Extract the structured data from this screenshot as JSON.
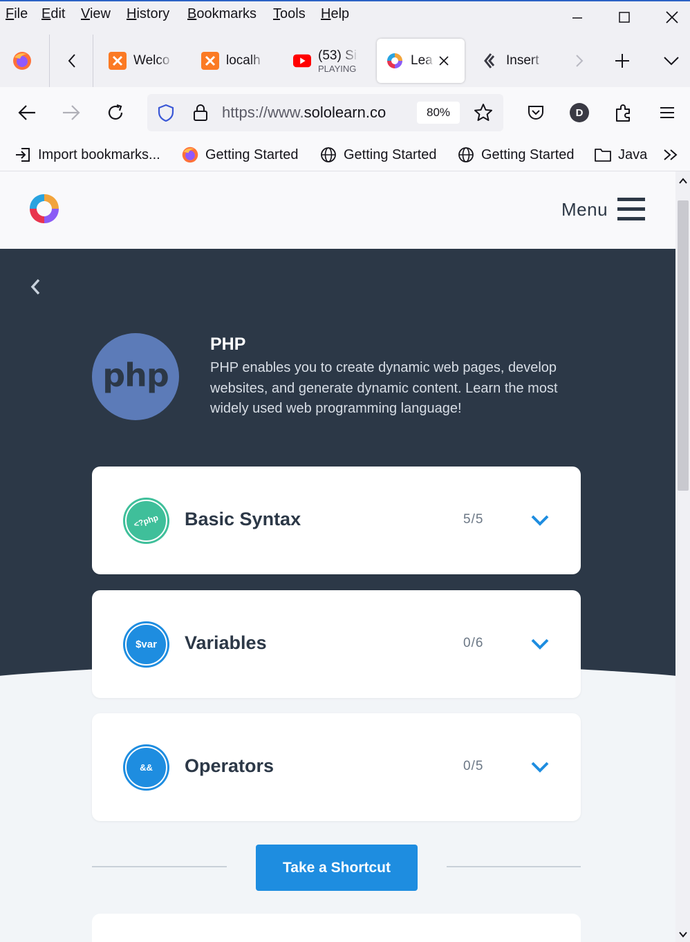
{
  "menubar": {
    "items": [
      "File",
      "Edit",
      "View",
      "History",
      "Bookmarks",
      "Tools",
      "Help"
    ]
  },
  "tabs": [
    {
      "title": "Welco",
      "icon": "xampp-icon"
    },
    {
      "title": "localh",
      "icon": "xampp-icon"
    },
    {
      "title": "(53) Si",
      "subtitle": "PLAYING",
      "icon": "youtube-icon"
    },
    {
      "title": "Lea",
      "icon": "sololearn-icon",
      "active": true
    },
    {
      "title": "Insert",
      "icon": "code-icon"
    }
  ],
  "navbar": {
    "url_scheme": "https://www.",
    "url_host": "sololearn.co",
    "zoom": "80%",
    "profile_initial": "D"
  },
  "bookmarks": [
    {
      "label": "Import bookmarks...",
      "icon": "import-icon"
    },
    {
      "label": "Getting Started",
      "icon": "firefox-icon"
    },
    {
      "label": "Getting Started",
      "icon": "globe-icon"
    },
    {
      "label": "Getting Started",
      "icon": "globe-icon"
    },
    {
      "label": "Java",
      "icon": "folder-icon"
    }
  ],
  "site": {
    "menu_label": "Menu"
  },
  "course": {
    "badge_text": "php",
    "title": "PHP",
    "description": "PHP enables you to create dynamic web pages, develop websites, and generate dynamic content. Learn the most widely used web programming language!"
  },
  "modules": [
    {
      "name": "Basic Syntax",
      "progress": "5/5",
      "icon_text": "<?php",
      "color": "#3fbf9a"
    },
    {
      "name": "Variables",
      "progress": "0/6",
      "icon_text": "$var",
      "color": "#1e8de0"
    },
    {
      "name": "Operators",
      "progress": "0/5",
      "icon_text": "&&",
      "color": "#1e8de0"
    }
  ],
  "shortcut": {
    "label": "Take a Shortcut"
  },
  "colors": {
    "hero_bg": "#2c3847",
    "accent": "#1e8de0",
    "completed": "#3fbf9a"
  }
}
